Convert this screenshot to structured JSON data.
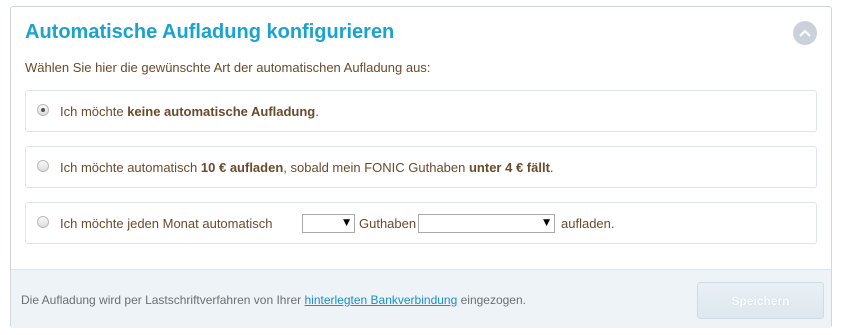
{
  "panel": {
    "title": "Automatische Aufladung konfigurieren",
    "subtitle": "Wählen Sie hier die gewünschte Art der automatischen Aufladung aus:",
    "collapse_icon": "chevron-up-icon"
  },
  "options": [
    {
      "checked": true,
      "pre": "Ich möchte ",
      "bold1": "keine automatische Aufladung",
      "post": "."
    },
    {
      "checked": false,
      "pre": "Ich möchte automatisch ",
      "bold1": "10 € aufladen",
      "mid": ", sobald mein FONIC Guthaben ",
      "bold2": "unter 4 € fällt",
      "post": "."
    },
    {
      "checked": false,
      "pre": "Ich möchte jeden Monat automatisch",
      "select1_value": "",
      "between": "Guthaben",
      "select2_value": "",
      "post": "aufladen."
    }
  ],
  "footer": {
    "text_pre": "Die Aufladung wird per Lastschriftverfahren von Ihrer ",
    "link": "hinterlegten Bankverbindung",
    "text_post": " eingezogen.",
    "save_label": "Speichern"
  },
  "colors": {
    "title": "#1aa3cf",
    "text": "#6b4a2a",
    "link": "#1a8fc7",
    "footer_bg": "#eef3f8"
  }
}
